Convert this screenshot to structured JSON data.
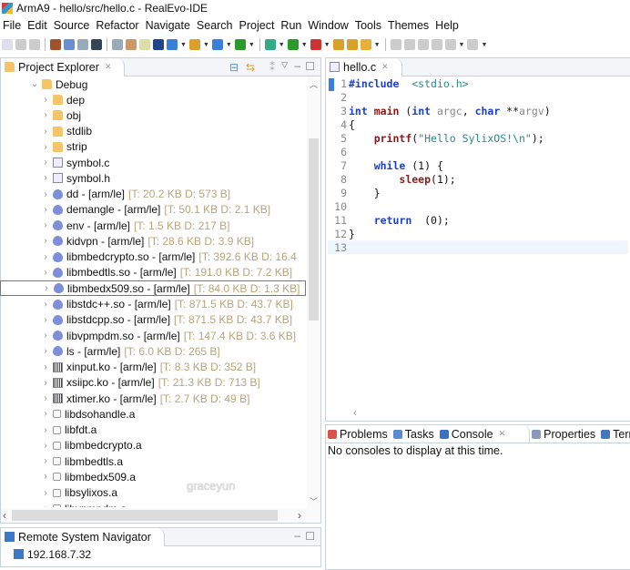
{
  "window": {
    "title": "ArmA9 - hello/src/hello.c - RealEvo-IDE"
  },
  "menu": [
    "File",
    "Edit",
    "Source",
    "Refactor",
    "Navigate",
    "Search",
    "Project",
    "Run",
    "Window",
    "Tools",
    "Themes",
    "Help"
  ],
  "project_explorer": {
    "title": "Project Explorer",
    "root": {
      "label": "Debug",
      "icon": "folder-open-icon"
    },
    "items": [
      {
        "label": "dep",
        "icon": "folder"
      },
      {
        "label": "obj",
        "icon": "folder"
      },
      {
        "label": "stdlib",
        "icon": "folder"
      },
      {
        "label": "strip",
        "icon": "folder"
      },
      {
        "label": "symbol.c",
        "icon": "cfile"
      },
      {
        "label": "symbol.h",
        "icon": "cfile"
      },
      {
        "label": "dd - [arm/le]",
        "meta": "[T: 20.2 KB  D: 573 B]",
        "icon": "bin"
      },
      {
        "label": "demangle - [arm/le]",
        "meta": "[T: 50.1 KB  D: 2.1 KB]",
        "icon": "bin"
      },
      {
        "label": "env - [arm/le]",
        "meta": "[T: 1.5 KB  D: 217 B]",
        "icon": "bin"
      },
      {
        "label": "kidvpn - [arm/le]",
        "meta": "[T: 28.6 KB  D: 3.9 KB]",
        "icon": "bin"
      },
      {
        "label": "libmbedcrypto.so - [arm/le]",
        "meta": "[T: 392.6 KB  D: 16.4",
        "icon": "bin"
      },
      {
        "label": "libmbedtls.so - [arm/le]",
        "meta": "[T: 191.0 KB  D: 7.2 KB]",
        "icon": "bin"
      },
      {
        "label": "libmbedx509.so - [arm/le]",
        "meta": "[T: 84.0 KB  D: 1.3 KB]",
        "icon": "bin",
        "selected": true
      },
      {
        "label": "libstdc++.so - [arm/le]",
        "meta": "[T: 871.5 KB  D: 43.7 KB]",
        "icon": "bin"
      },
      {
        "label": "libstdcpp.so - [arm/le]",
        "meta": "[T: 871.5 KB  D: 43.7 KB]",
        "icon": "bin"
      },
      {
        "label": "libvpmpdm.so - [arm/le]",
        "meta": "[T: 147.4 KB  D: 3.6 KB]",
        "icon": "bin"
      },
      {
        "label": "ls - [arm/le]",
        "meta": "[T: 6.0 KB  D: 265 B]",
        "icon": "bin"
      },
      {
        "label": "xinput.ko - [arm/le]",
        "meta": "[T: 8.3 KB  D: 352 B]",
        "icon": "ko"
      },
      {
        "label": "xsiipc.ko - [arm/le]",
        "meta": "[T: 21.3 KB  D: 713 B]",
        "icon": "ko"
      },
      {
        "label": "xtimer.ko - [arm/le]",
        "meta": "[T: 2.7 KB  D: 49 B]",
        "icon": "ko"
      },
      {
        "label": "libdsohandle.a",
        "icon": "arc"
      },
      {
        "label": "libfdt.a",
        "icon": "arc"
      },
      {
        "label": "libmbedcrypto.a",
        "icon": "arc"
      },
      {
        "label": "libmbedtls.a",
        "icon": "arc"
      },
      {
        "label": "libmbedx509.a",
        "icon": "arc"
      },
      {
        "label": "libsylixos.a",
        "icon": "arc"
      },
      {
        "label": "libvpmpdm.a",
        "icon": "arc"
      }
    ]
  },
  "watermark": "graceyun",
  "remote_navigator": {
    "title": "Remote System Navigator",
    "items": [
      "192.168.7.32"
    ]
  },
  "editor": {
    "tab": "hello.c",
    "lines": [
      [
        [
          "kw",
          "#include"
        ],
        [
          "",
          "  "
        ],
        [
          "str",
          "<stdio.h>"
        ]
      ],
      [],
      [
        [
          "kw",
          "int"
        ],
        [
          "",
          " "
        ],
        [
          "fn",
          "main"
        ],
        [
          "",
          " ("
        ],
        [
          "kw",
          "int"
        ],
        [
          "",
          " "
        ],
        [
          "prm",
          "argc"
        ],
        [
          "",
          ", "
        ],
        [
          "kw",
          "char"
        ],
        [
          "",
          " **"
        ],
        [
          "prm",
          "argv"
        ],
        [
          "",
          ")"
        ]
      ],
      [
        [
          "",
          "{"
        ]
      ],
      [
        [
          "",
          "    "
        ],
        [
          "fn",
          "printf"
        ],
        [
          "",
          "("
        ],
        [
          "str",
          "\"Hello SylixOS!\\n\""
        ],
        [
          "",
          ");"
        ]
      ],
      [],
      [
        [
          "",
          "    "
        ],
        [
          "kw",
          "while"
        ],
        [
          "",
          " (1) {"
        ]
      ],
      [
        [
          "",
          "        "
        ],
        [
          "fn",
          "sleep"
        ],
        [
          "",
          "(1);"
        ]
      ],
      [
        [
          "",
          "    }"
        ]
      ],
      [],
      [
        [
          "",
          "    "
        ],
        [
          "kw",
          "return"
        ],
        [
          "",
          "  (0);"
        ]
      ],
      [
        [
          "",
          "}"
        ]
      ],
      []
    ]
  },
  "bottom": {
    "tabs": [
      {
        "label": "Problems",
        "color": "#d9534f"
      },
      {
        "label": "Tasks",
        "color": "#5b8bd0"
      },
      {
        "label": "Console",
        "color": "#3a6fc4",
        "active": true
      },
      {
        "label": "Properties",
        "color": "#8899bb"
      },
      {
        "label": "Term",
        "color": "#4477bb"
      }
    ],
    "message": "No consoles to display at this time."
  }
}
